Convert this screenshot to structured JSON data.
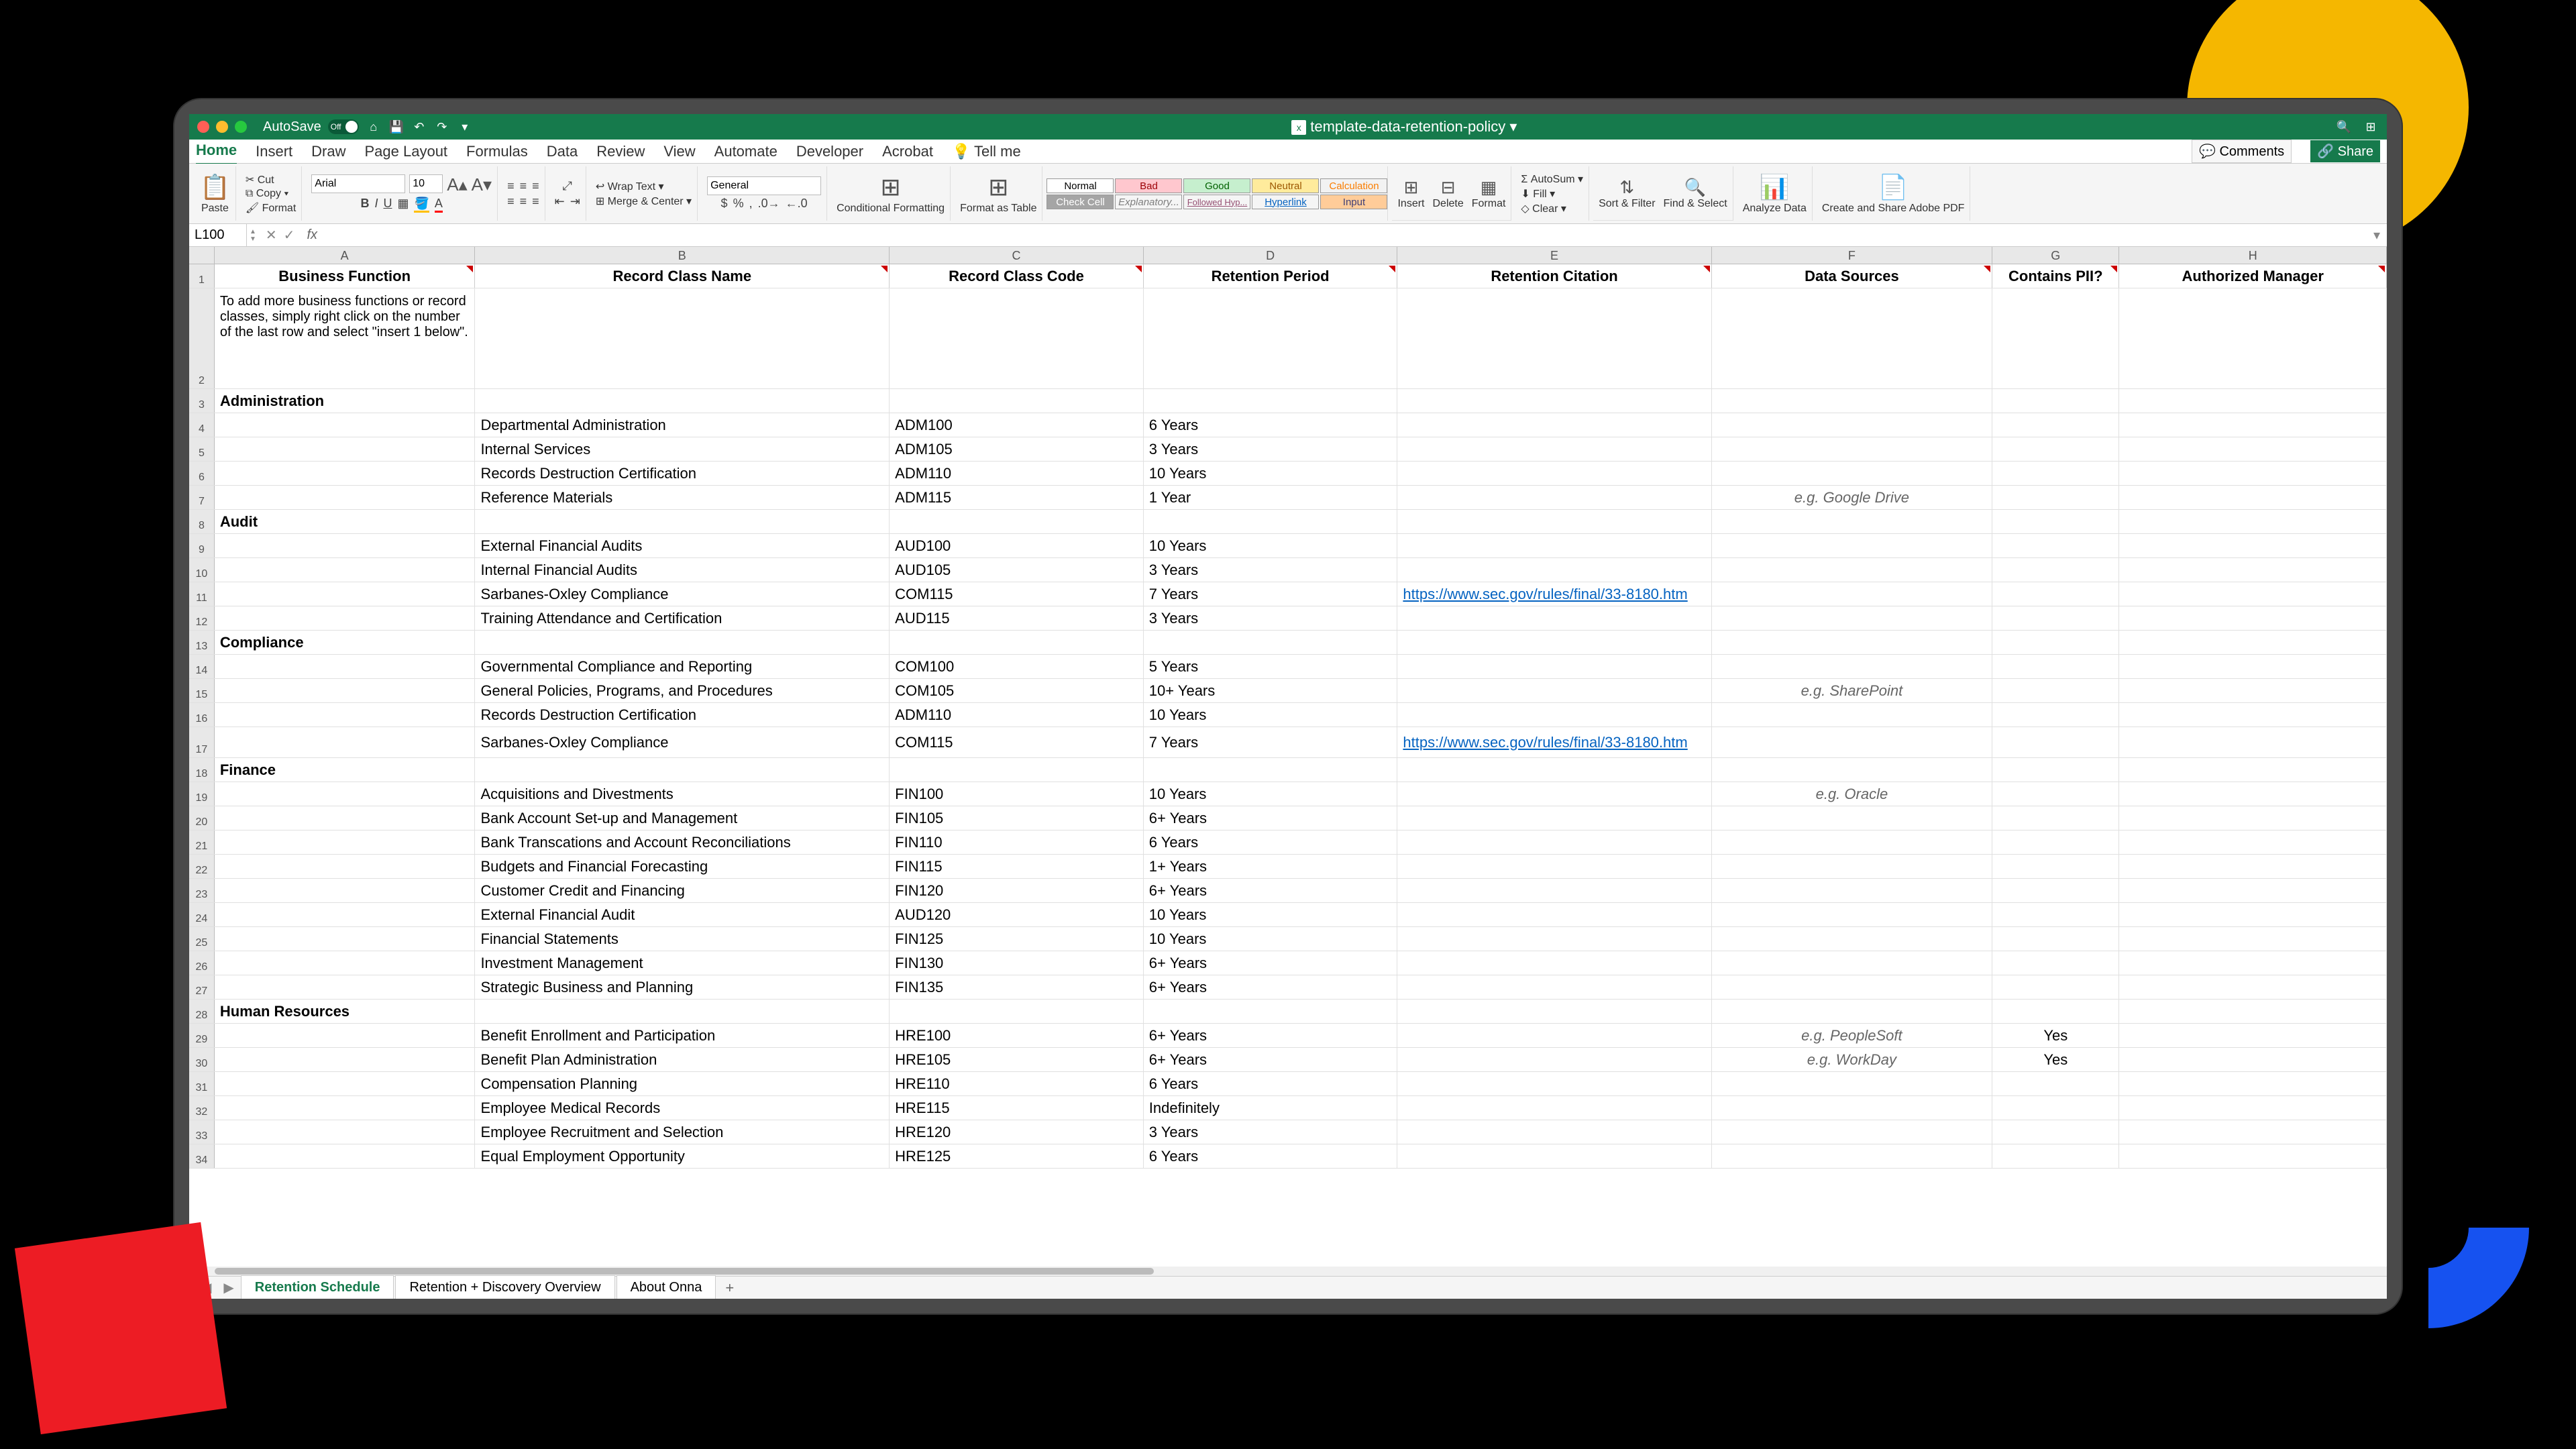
{
  "titlebar": {
    "autosave_label": "AutoSave",
    "autosave_state": "Off",
    "filename": "template-data-retention-policy"
  },
  "tabs": [
    "Home",
    "Insert",
    "Draw",
    "Page Layout",
    "Formulas",
    "Data",
    "Review",
    "View",
    "Automate",
    "Developer",
    "Acrobat"
  ],
  "tellme": "Tell me",
  "comments_label": "Comments",
  "share_label": "Share",
  "ribbon": {
    "paste": "Paste",
    "cut": "Cut",
    "copy": "Copy",
    "format_paint": "Format",
    "font_name": "Arial",
    "font_size": "10",
    "wrap": "Wrap Text",
    "merge": "Merge & Center",
    "num_format": "General",
    "cond": "Conditional Formatting",
    "fmt_table": "Format as Table",
    "styles": {
      "normal": "Normal",
      "bad": "Bad",
      "good": "Good",
      "neutral": "Neutral",
      "calc": "Calculation",
      "check": "Check Cell",
      "expl": "Explanatory...",
      "follow": "Followed Hyp...",
      "hyper": "Hyperlink",
      "input": "Input"
    },
    "insert": "Insert",
    "delete": "Delete",
    "format": "Format",
    "autosum": "AutoSum",
    "fill": "Fill",
    "clear": "Clear",
    "sort": "Sort & Filter",
    "find": "Find & Select",
    "analyze": "Analyze Data",
    "pdf": "Create and Share Adobe PDF"
  },
  "namebox": "L100",
  "col_letters": [
    "A",
    "B",
    "C",
    "D",
    "E",
    "F",
    "G",
    "H"
  ],
  "headers": [
    "Business Function",
    "Record Class Name",
    "Record Class Code",
    "Retention Period",
    "Retention Citation",
    "Data Sources",
    "Contains PII?",
    "Authorized Manager"
  ],
  "note_text": "To add more business functions or record classes, simply right click on the number of the last row and select \"insert 1 below\".",
  "rows": [
    {
      "n": 3,
      "section": "Administration"
    },
    {
      "n": 4,
      "b": "Departmental Administration",
      "c": "ADM100",
      "d": "6 Years"
    },
    {
      "n": 5,
      "b": "Internal Services",
      "c": "ADM105",
      "d": "3 Years"
    },
    {
      "n": 6,
      "b": "Records Destruction Certification",
      "c": "ADM110",
      "d": "10 Years"
    },
    {
      "n": 7,
      "b": "Reference Materials",
      "c": "ADM115",
      "d": "1 Year",
      "f": "e.g. Google Drive"
    },
    {
      "n": 8,
      "section": "Audit"
    },
    {
      "n": 9,
      "b": "External Financial Audits",
      "c": "AUD100",
      "d": "10 Years"
    },
    {
      "n": 10,
      "b": "Internal Financial Audits",
      "c": "AUD105",
      "d": "3 Years"
    },
    {
      "n": 11,
      "b": "Sarbanes-Oxley Compliance",
      "c": "COM115",
      "d": "7 Years",
      "e": "https://www.sec.gov/rules/final/33-8180.htm"
    },
    {
      "n": 12,
      "b": "Training Attendance and Certification",
      "c": "AUD115",
      "d": "3 Years"
    },
    {
      "n": 13,
      "section": "Compliance"
    },
    {
      "n": 14,
      "b": "Governmental Compliance and Reporting",
      "c": "COM100",
      "d": "5 Years"
    },
    {
      "n": 15,
      "b": "General Policies, Programs, and Procedures",
      "c": "COM105",
      "d": "10+ Years",
      "f": "e.g. SharePoint"
    },
    {
      "n": 16,
      "b": "Records Destruction Certification",
      "c": "ADM110",
      "d": "10 Years"
    },
    {
      "n": 17,
      "b": "Sarbanes-Oxley Compliance",
      "c": "COM115",
      "d": "7 Years",
      "e": "https://www.sec.gov/rules/final/33-8180.htm",
      "tall": true
    },
    {
      "n": 18,
      "section": "Finance"
    },
    {
      "n": 19,
      "b": "Acquisitions and Divestments",
      "c": "FIN100",
      "d": "10 Years",
      "f": "e.g. Oracle"
    },
    {
      "n": 20,
      "b": "Bank Account Set-up and Management",
      "c": "FIN105",
      "d": "6+ Years"
    },
    {
      "n": 21,
      "b": "Bank Transcations and Account Reconciliations",
      "c": "FIN110",
      "d": "6 Years"
    },
    {
      "n": 22,
      "b": "Budgets and Financial Forecasting",
      "c": "FIN115",
      "d": "1+ Years"
    },
    {
      "n": 23,
      "b": "Customer Credit and Financing",
      "c": "FIN120",
      "d": "6+ Years"
    },
    {
      "n": 24,
      "b": "External Financial Audit",
      "c": "AUD120",
      "d": "10 Years"
    },
    {
      "n": 25,
      "b": "Financial Statements",
      "c": "FIN125",
      "d": "10 Years"
    },
    {
      "n": 26,
      "b": "Investment Management",
      "c": "FIN130",
      "d": "6+ Years"
    },
    {
      "n": 27,
      "b": "Strategic Business and Planning",
      "c": "FIN135",
      "d": "6+ Years"
    },
    {
      "n": 28,
      "section": "Human Resources"
    },
    {
      "n": 29,
      "b": "Benefit Enrollment and Participation",
      "c": "HRE100",
      "d": "6+ Years",
      "f": "e.g. PeopleSoft",
      "g": "Yes"
    },
    {
      "n": 30,
      "b": "Benefit Plan Administration",
      "c": "HRE105",
      "d": "6+ Years",
      "f": "e.g. WorkDay",
      "g": "Yes"
    },
    {
      "n": 31,
      "b": "Compensation Planning",
      "c": "HRE110",
      "d": "6 Years"
    },
    {
      "n": 32,
      "b": "Employee Medical Records",
      "c": "HRE115",
      "d": "Indefinitely"
    },
    {
      "n": 33,
      "b": "Employee Recruitment and Selection",
      "c": "HRE120",
      "d": "3 Years"
    },
    {
      "n": 34,
      "b": "Equal Employment Opportunity",
      "c": "HRE125",
      "d": "6 Years"
    }
  ],
  "sheets": [
    "Retention Schedule",
    "Retention + Discovery Overview",
    "About Onna"
  ]
}
